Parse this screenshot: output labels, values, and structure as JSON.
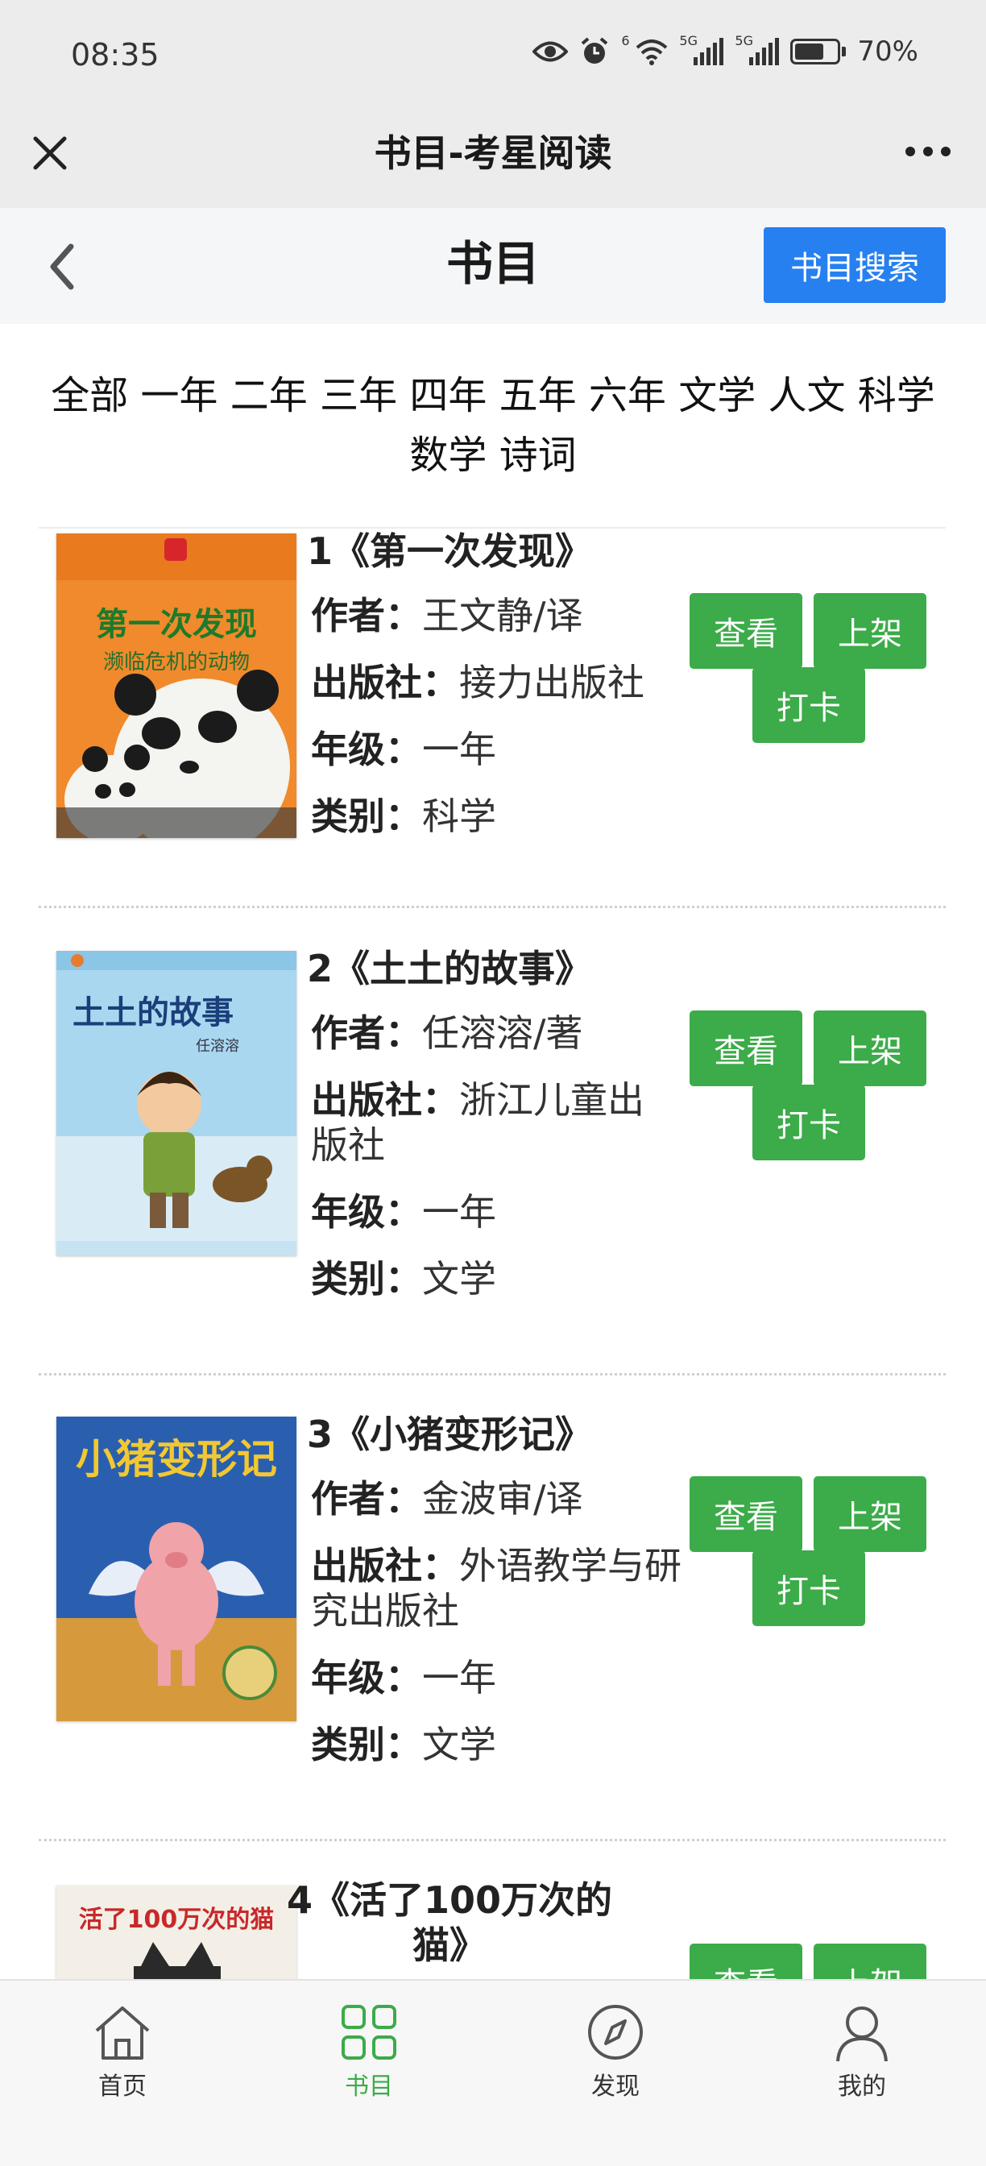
{
  "status_bar": {
    "time": "08:35",
    "network_1": "5G",
    "network_2": "5G",
    "wifi_badge": "6",
    "battery_level": 0.7,
    "battery_text": "70%",
    "icons": [
      "eye-icon",
      "alarm-icon",
      "wifi-icon",
      "signal-icon",
      "signal-icon",
      "battery-icon"
    ]
  },
  "wechat_bar": {
    "title": "书目-考星阅读",
    "icons": [
      "close-icon",
      "more-icon"
    ]
  },
  "page_header": {
    "title": "书目",
    "search_button": "书目搜索",
    "accent_color": "#2680f0"
  },
  "categories": [
    "全部",
    "一年",
    "二年",
    "三年",
    "四年",
    "五年",
    "六年",
    "文学",
    "人文",
    "科学",
    "数学",
    "诗词"
  ],
  "labels": {
    "author": "作者：",
    "publisher": "出版社：",
    "grade": "年级：",
    "category": "类别："
  },
  "buttons": {
    "view": "查看",
    "shelve": "上架",
    "checkin": "打卡",
    "color": "#3cab49"
  },
  "books": [
    {
      "title": "1《第一次发现》",
      "author": "王文静/译",
      "publisher": "接力出版社",
      "grade": "一年",
      "category": "科学",
      "cover": {
        "series": "第一次发现",
        "subtitle": "濒临危机的动物",
        "bg_color": "#f08a2c"
      }
    },
    {
      "title": "2《土土的故事》",
      "author": "任溶溶/著",
      "publisher": "浙江儿童出版社",
      "grade": "一年",
      "category": "文学",
      "cover": {
        "name": "土土的故事",
        "author": "任溶溶",
        "bg_color": "#a9d7f0"
      }
    },
    {
      "title": "3《小猪变形记》",
      "author": "金波审/译",
      "publisher": "外语教学与研究出版社",
      "grade": "一年",
      "category": "文学",
      "cover": {
        "name": "小猪变形记",
        "bg_color": "#2a5fb0"
      }
    },
    {
      "title": "4《活了100万次的猫》",
      "cover": {
        "name": "活了100万次的猫",
        "bg_color": "#f3efe6"
      }
    }
  ],
  "tabbar": {
    "items": [
      {
        "label": "首页",
        "icon": "home-icon"
      },
      {
        "label": "书目",
        "icon": "grid-icon"
      },
      {
        "label": "发现",
        "icon": "compass-icon"
      },
      {
        "label": "我的",
        "icon": "user-icon"
      }
    ],
    "active_index": 1,
    "active_color": "#3cab49"
  }
}
